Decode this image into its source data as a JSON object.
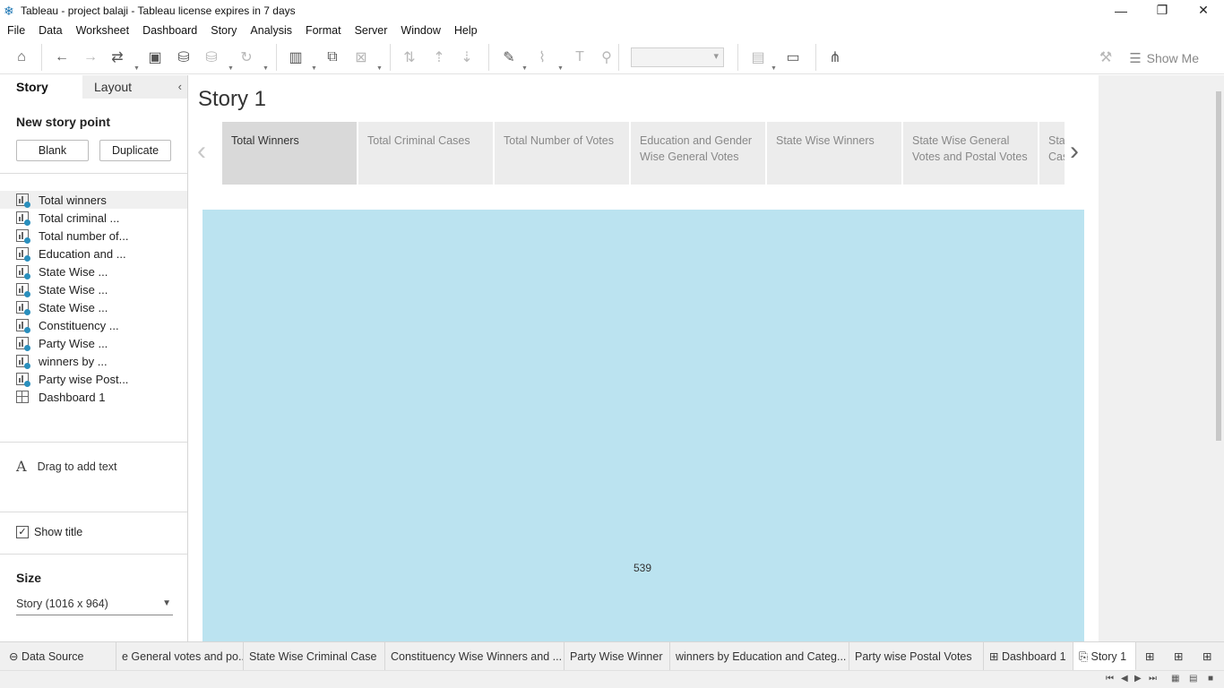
{
  "window": {
    "title": "Tableau - project balaji - Tableau license expires in 7 days",
    "app_icon": "tableau-logo-icon",
    "controls": [
      "minimize-icon",
      "restore-icon",
      "close-icon"
    ]
  },
  "menu": [
    "File",
    "Data",
    "Worksheet",
    "Dashboard",
    "Story",
    "Analysis",
    "Format",
    "Server",
    "Window",
    "Help"
  ],
  "toolbar": {
    "show_me": "Show Me"
  },
  "left_panel": {
    "tabs": {
      "story": "Story",
      "layout": "Layout"
    },
    "new_story_point": "New story point",
    "blank": "Blank",
    "duplicate": "Duplicate",
    "sheets": [
      {
        "label": "Total winners",
        "type": "sheet",
        "selected": true
      },
      {
        "label": "Total criminal ...",
        "type": "sheet"
      },
      {
        "label": "Total number of...",
        "type": "sheet"
      },
      {
        "label": "Education and ...",
        "type": "sheet"
      },
      {
        "label": "State Wise ...",
        "type": "sheet"
      },
      {
        "label": "State Wise ...",
        "type": "sheet"
      },
      {
        "label": "State Wise ...",
        "type": "sheet"
      },
      {
        "label": "Constituency ...",
        "type": "sheet"
      },
      {
        "label": "Party Wise ...",
        "type": "sheet"
      },
      {
        "label": "winners by ...",
        "type": "sheet"
      },
      {
        "label": "Party wise Post...",
        "type": "sheet"
      },
      {
        "label": "Dashboard 1",
        "type": "dashboard"
      }
    ],
    "drag_text": "Drag to add text",
    "show_title": "Show title",
    "show_title_checked": true,
    "size_label": "Size",
    "size_value": "Story (1016 x 964)"
  },
  "story": {
    "title": "Story 1",
    "points": [
      "Total Winners",
      "Total Criminal Cases",
      "Total Number of Votes",
      "Education and Gender Wise General Votes",
      "State Wise Winners",
      "State Wise General Votes and Postal Votes",
      "State Wise Criminal Cases"
    ],
    "active_point": 0,
    "viz_value": "539",
    "viz_color": "#bbe3f0"
  },
  "bottom_tabs": {
    "data_source": "Data Source",
    "tabs": [
      "e General votes and po...",
      "State Wise Criminal Case",
      "Constituency Wise Winners and ...",
      "Party Wise Winner",
      "winners by Education and Categ...",
      "Party wise Postal Votes",
      "Dashboard 1",
      "Story 1"
    ],
    "active": "Story 1"
  }
}
